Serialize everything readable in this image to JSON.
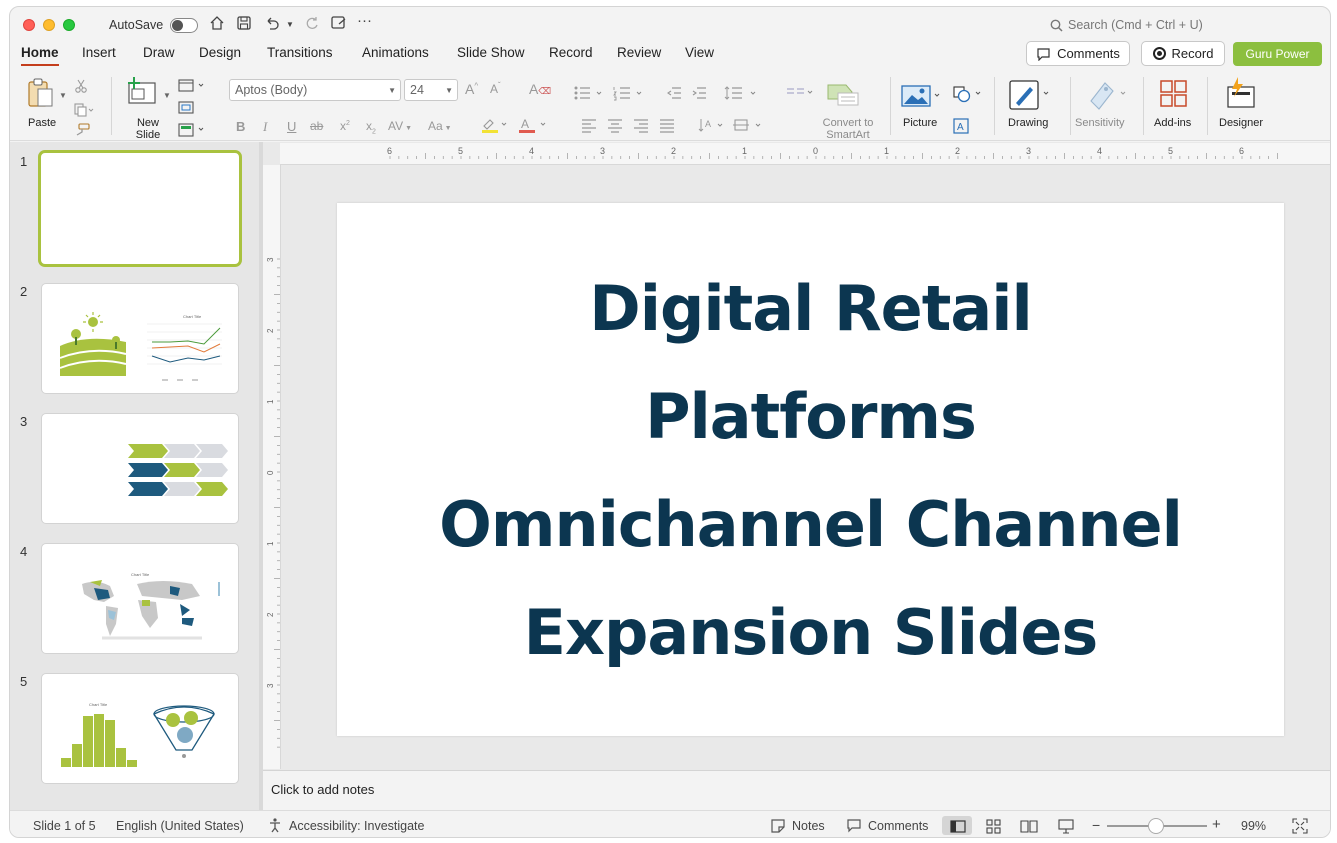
{
  "titlebar": {
    "autosave_label": "AutoSave",
    "search_placeholder": "Search (Cmd + Ctrl + U)"
  },
  "tabs": [
    "Home",
    "Insert",
    "Draw",
    "Design",
    "Transitions",
    "Animations",
    "Slide Show",
    "Record",
    "Review",
    "View"
  ],
  "header_buttons": {
    "comments": "Comments",
    "record": "Record",
    "guru": "Guru Power"
  },
  "ribbon": {
    "paste": "Paste",
    "new_slide": "New Slide",
    "font_name": "Aptos (Body)",
    "font_size": "24",
    "convert_smartart": "Convert to SmartArt",
    "picture": "Picture",
    "drawing": "Drawing",
    "sensitivity": "Sensitivity",
    "addins": "Add-ins",
    "designer": "Designer"
  },
  "thumbnails": [
    "1",
    "2",
    "3",
    "4",
    "5"
  ],
  "thumb_chart_title": "Chart Title",
  "slide": {
    "title_line1": "Digital Retail",
    "title_line2": "Platforms",
    "title_line3": "Omnichannel Channel",
    "title_line4": "Expansion Slides"
  },
  "notes_placeholder": "Click to add notes",
  "status": {
    "slide_count": "Slide 1 of 5",
    "language": "English (United States)",
    "accessibility": "Accessibility: Investigate",
    "notes": "Notes",
    "comments": "Comments",
    "zoom": "99%"
  },
  "ruler_h": [
    "6",
    "5",
    "4",
    "3",
    "2",
    "1",
    "0",
    "1",
    "2",
    "3",
    "4",
    "5",
    "6"
  ],
  "ruler_v": [
    "3",
    "2",
    "1",
    "0",
    "1",
    "2",
    "3"
  ],
  "colors": {
    "accent": "#c43e1c",
    "title_text": "#0c3650",
    "brand_green": "#8cbf3f",
    "thumb_green": "#a9c23f",
    "thumb_navy": "#1e5a7e"
  }
}
